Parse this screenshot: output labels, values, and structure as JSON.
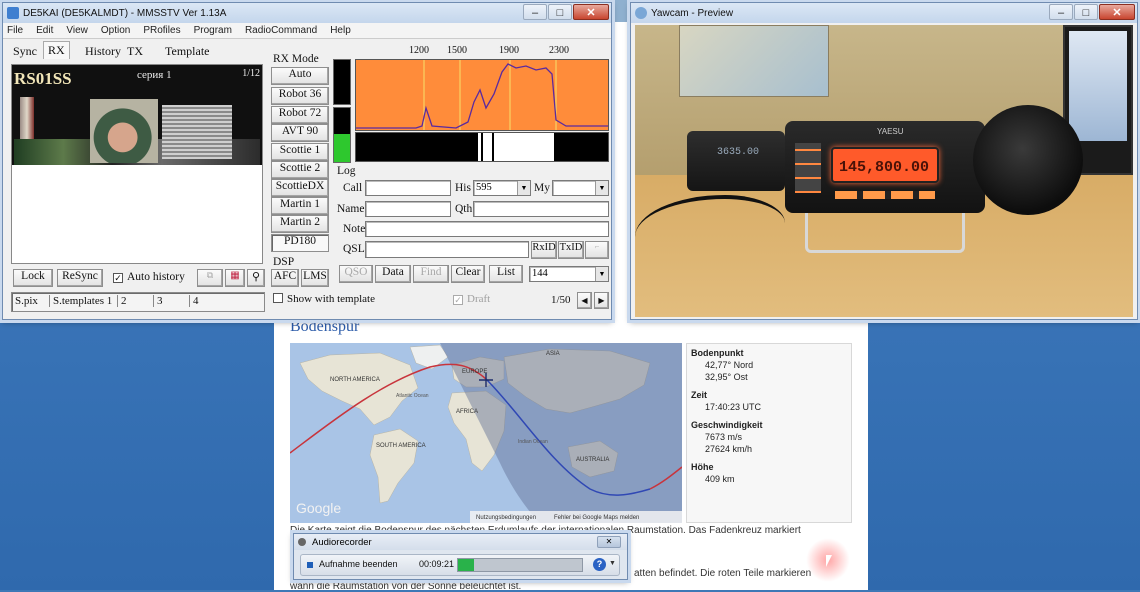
{
  "mmsstv": {
    "title": "DE5KAI (DE5KALMDT) - MMSSTV Ver 1.13A",
    "menu": [
      "File",
      "Edit",
      "View",
      "Option",
      "PRofiles",
      "Program",
      "RadioCommand",
      "Help"
    ],
    "tabs": [
      "Sync",
      "RX",
      "History",
      "TX",
      "Template"
    ],
    "active_tab": "RX",
    "rx_image": {
      "callsign": "RS01SS",
      "caption": "серия 1",
      "counter": "1/12"
    },
    "rx_mode_label": "RX Mode",
    "rx_modes": [
      "Auto",
      "Robot 36",
      "Robot 72",
      "AVT 90",
      "Scottie 1",
      "Scottie 2",
      "ScottieDX",
      "Martin 1",
      "Martin 2",
      "PD180"
    ],
    "selected_mode": "PD180",
    "spectrum_ticks": [
      "1200",
      "1500",
      "1900",
      "2300"
    ],
    "log": {
      "label": "Log",
      "call_label": "Call",
      "his_label": "His",
      "his_value": "595",
      "my_label": "My",
      "name_label": "Name",
      "qth_label": "Qth",
      "note_label": "Note",
      "qsl_label": "QSL",
      "rxid": "RxID",
      "txid": "TxID",
      "buttons": [
        "QSO",
        "Data",
        "Find",
        "Clear",
        "List"
      ],
      "freq": "144"
    },
    "bottom": {
      "lock": "Lock",
      "resync": "ReSync",
      "auto_history": "Auto history",
      "auto_history_checked": true,
      "dsp_label": "DSP",
      "afc": "AFC",
      "lms": "LMS",
      "show_template": "Show with template",
      "draft": "Draft",
      "pager": "1/50"
    },
    "bottom_tabs": [
      "S.pix",
      "S.templates 1",
      "2",
      "3",
      "4"
    ]
  },
  "yawcam": {
    "title": "Yawcam - Preview",
    "radio_display": "145,800.00",
    "radio_brand": "YAESU",
    "radio_small": "3635.00"
  },
  "web": {
    "heading": "Bodenspur",
    "map": {
      "labels": [
        "NORTH AMERICA",
        "SOUTH AMERICA",
        "EUROPE",
        "AFRICA",
        "ASIA",
        "AUSTRALIA",
        "Atlantic Ocean",
        "Indian Ocean"
      ],
      "google": "Google",
      "footer_terms": "Nutzungsbedingungen",
      "footer_report": "Fehler bei Google Maps melden"
    },
    "info": {
      "ground_point_label": "Bodenpunkt",
      "lat": "42,77° Nord",
      "lon": "32,95° Ost",
      "time_label": "Zeit",
      "time": "17:40:23 UTC",
      "speed_label": "Geschwindigkeit",
      "speed_ms": "7673 m/s",
      "speed_kmh": "27624 km/h",
      "altitude_label": "Höhe",
      "altitude": "409 km"
    },
    "text1": "Die Karte zeigt die Bodenspur des nächsten Erdumlaufs der internationalen Raumstation. Das Fadenkreuz markiert",
    "text2": "atten befindet. Die roten Teile markieren",
    "text3": "wann die Raumstation von der Sonne beleuchtet ist."
  },
  "audiorecorder": {
    "title": "Audiorecorder",
    "stop_label": "Aufnahme beenden",
    "elapsed": "00:09:21"
  },
  "colors": {
    "spectrum_bg": "#ff8c3a",
    "spectrum_line": "#5a2aa0",
    "map_ocean": "#a9c4e6",
    "night": "#5f6f94",
    "track_red": "#c8343c",
    "track_blue": "#3048b4",
    "radio_lcd": "#ff5a2a"
  }
}
